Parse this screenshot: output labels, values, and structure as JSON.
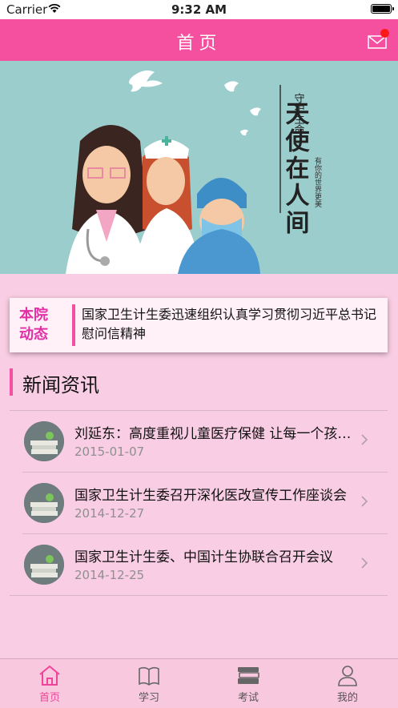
{
  "status_bar": {
    "carrier": "Carrier",
    "time": "9:32 AM"
  },
  "nav": {
    "title": "首页",
    "mail_icon": "mail-icon"
  },
  "banner": {
    "title_small": "守护生命",
    "title_large": "天使在人间",
    "subtitle": "有你的世界更美"
  },
  "notice": {
    "tag_line1": "本院",
    "tag_line2": "动态",
    "text": "国家卫生计生委迅速组织认真学习贯彻习近平总书记慰问信精神"
  },
  "news": {
    "header": "新闻资讯",
    "items": [
      {
        "title": "刘延东：高度重视儿童医疗保健 让每一个孩子健康成长",
        "date": "2015-01-07"
      },
      {
        "title": "国家卫生计生委召开深化医改宣传工作座谈会",
        "date": "2014-12-27"
      },
      {
        "title": "国家卫生计生委、中国计生协联合召开会议",
        "date": "2014-12-25"
      }
    ]
  },
  "tabbar": {
    "tabs": [
      {
        "label": "首页",
        "icon": "home-icon"
      },
      {
        "label": "学习",
        "icon": "book-icon"
      },
      {
        "label": "考试",
        "icon": "books-stack-icon"
      },
      {
        "label": "我的",
        "icon": "user-icon"
      }
    ]
  },
  "colors": {
    "accent": "#f54fa0",
    "background": "#f9cde3",
    "tag": "#e22fa6"
  }
}
